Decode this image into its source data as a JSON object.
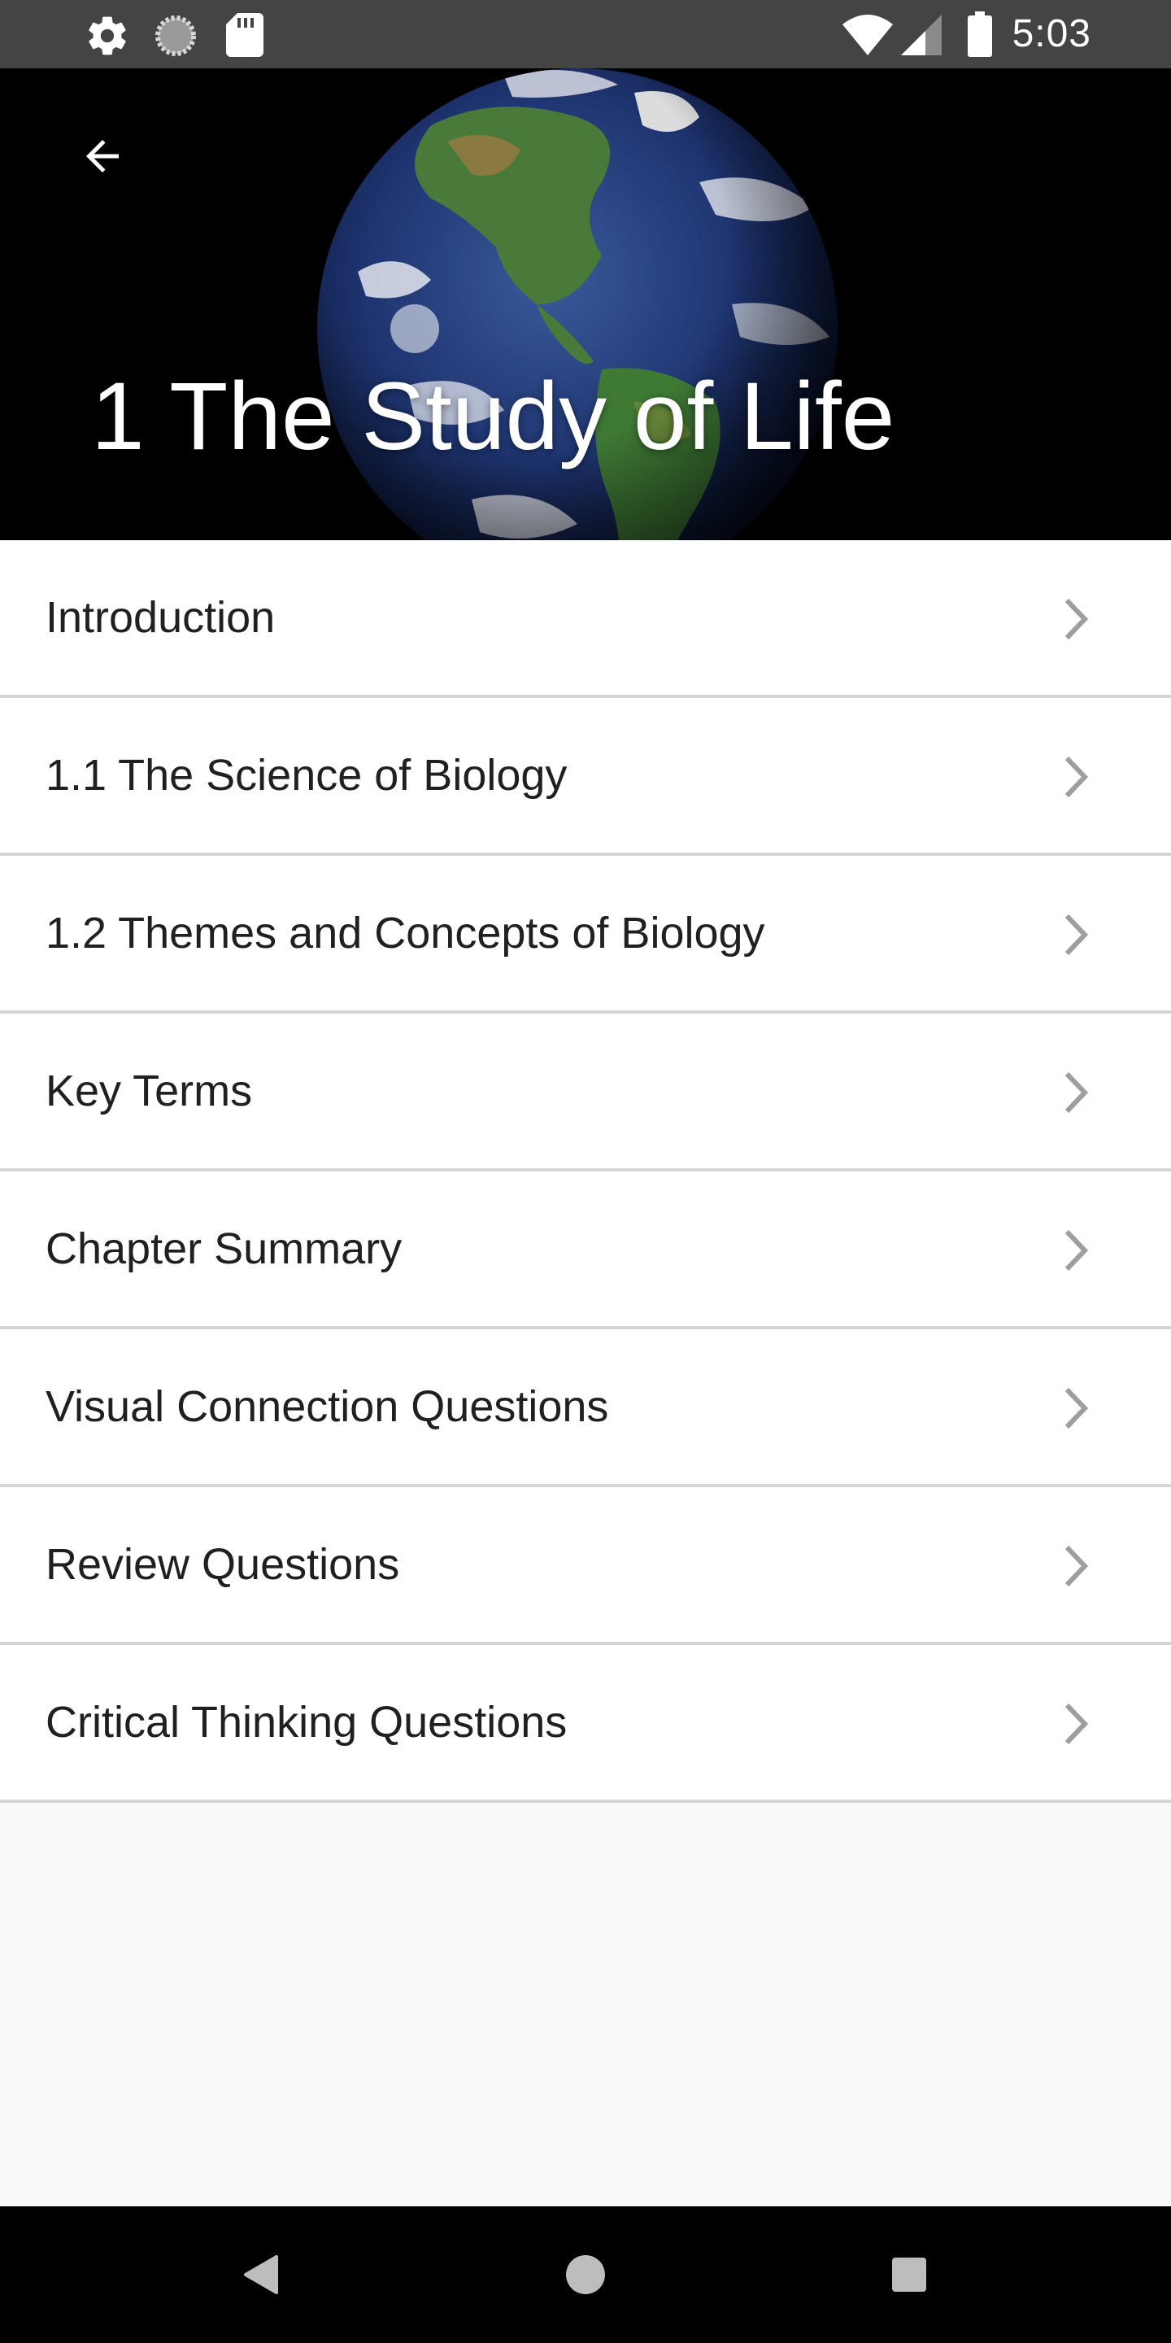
{
  "status_bar": {
    "time": "5:03",
    "left_icons": [
      "gear-icon",
      "loading-icon",
      "sd-card-icon"
    ],
    "right_icons": [
      "wifi-icon",
      "signal-icon",
      "battery-icon"
    ]
  },
  "header": {
    "title": "1 The Study of Life",
    "back_icon": "back-arrow-icon",
    "background": "earth-image"
  },
  "sections": [
    {
      "label": "Introduction"
    },
    {
      "label": "1.1 The Science of Biology"
    },
    {
      "label": "1.2 Themes and Concepts of Biology"
    },
    {
      "label": "Key Terms"
    },
    {
      "label": "Chapter Summary"
    },
    {
      "label": "Visual Connection Questions"
    },
    {
      "label": "Review Questions"
    },
    {
      "label": "Critical Thinking Questions"
    }
  ],
  "nav_bar": {
    "buttons": [
      "back-triangle-icon",
      "home-circle-icon",
      "recents-square-icon"
    ]
  },
  "colors": {
    "status_bar": "#444444",
    "header_bg": "#000000",
    "list_bg": "#ffffff",
    "divider": "#d4d4d4",
    "text": "#202020",
    "chevron": "#9e9e9e",
    "page_bg": "#f9f9f9",
    "nav_bar": "#000000"
  }
}
